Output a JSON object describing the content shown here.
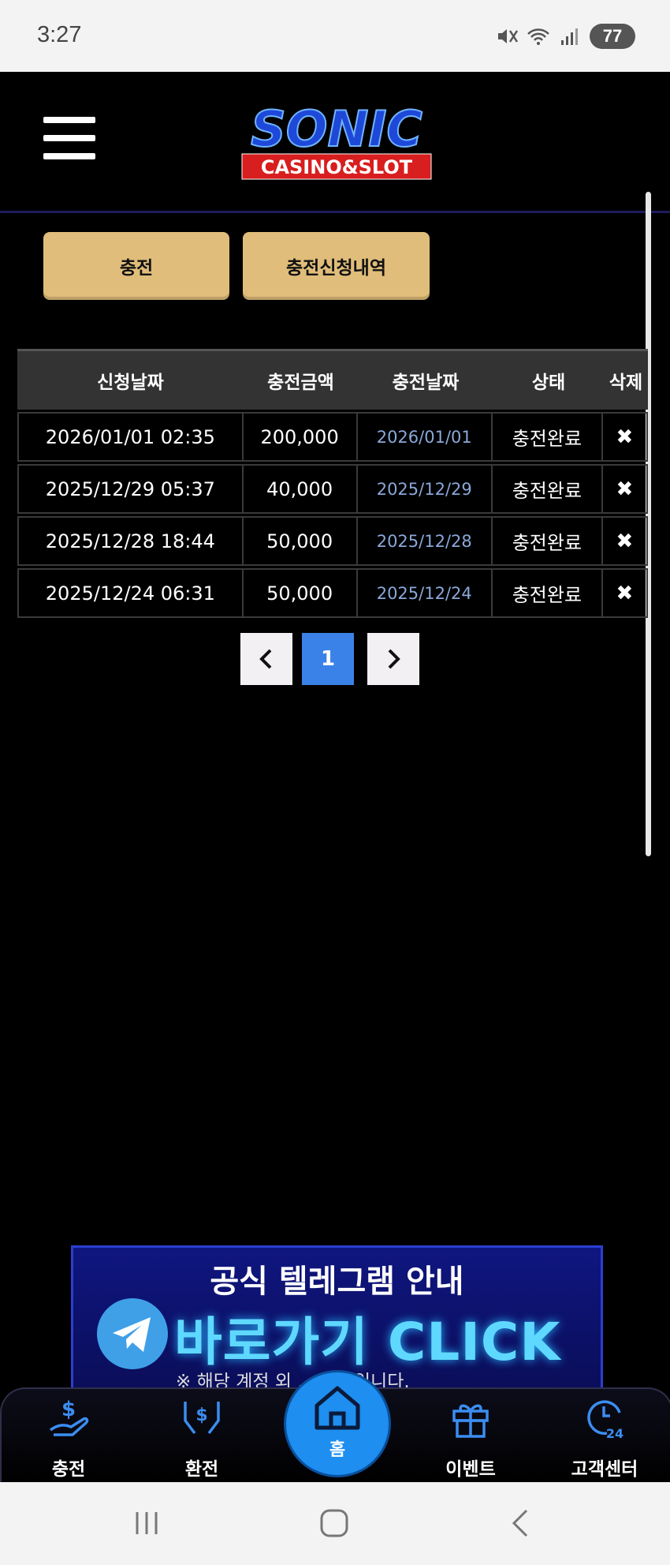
{
  "status_bar": {
    "time": "3:27",
    "battery": "77"
  },
  "header": {
    "logo_title": "SONIC",
    "logo_subtitle": "CASINO&SLOT"
  },
  "buttons": {
    "charge": "충전",
    "charge_history": "충전신청내역"
  },
  "table": {
    "headers": [
      "신청날짜",
      "충전금액",
      "충전날짜",
      "상태",
      "삭제"
    ],
    "rows": [
      {
        "request_date": "2026/01/01 02:35",
        "amount": "200,000",
        "charge_date": "2026/01/01",
        "status": "충전완료",
        "delete": "✖"
      },
      {
        "request_date": "2025/12/29 05:37",
        "amount": "40,000",
        "charge_date": "2025/12/29",
        "status": "충전완료",
        "delete": "✖"
      },
      {
        "request_date": "2025/12/28 18:44",
        "amount": "50,000",
        "charge_date": "2025/12/28",
        "status": "충전완료",
        "delete": "✖"
      },
      {
        "request_date": "2025/12/24 06:31",
        "amount": "50,000",
        "charge_date": "2025/12/24",
        "status": "충전완료",
        "delete": "✖"
      }
    ]
  },
  "pagination": {
    "current_page": "1"
  },
  "banner": {
    "title": "공식 텔레그램 안내",
    "cta": "바로가기 CLICK",
    "note": "※ 해당 계정 외 ... 사칭입니다."
  },
  "bottom_nav": {
    "items": [
      {
        "label": "충전",
        "icon": "deposit-hand-icon"
      },
      {
        "label": "환전",
        "icon": "exchange-hands-icon"
      },
      {
        "label": "홈",
        "icon": "home-icon"
      },
      {
        "label": "이벤트",
        "icon": "gift-icon"
      },
      {
        "label": "고객센터",
        "icon": "support-24-icon"
      }
    ]
  },
  "colors": {
    "gold_button": "#e0bd7a",
    "active_page": "#3b82e8",
    "nav_blue": "#1e8ef0",
    "date_blue": "#8aa8d8"
  }
}
